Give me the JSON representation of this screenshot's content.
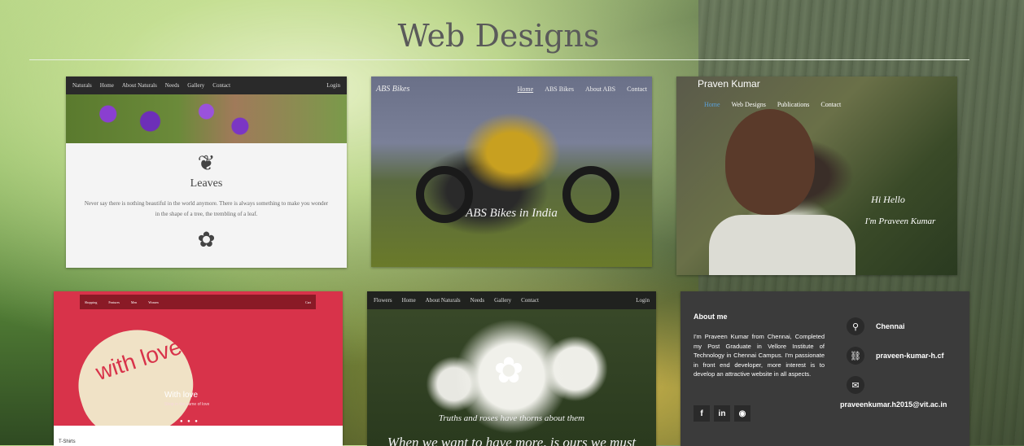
{
  "page": {
    "title": "Web Designs"
  },
  "cards": {
    "naturals": {
      "nav": [
        "Naturals",
        "Home",
        "About Naturals",
        "Needs",
        "Gallery",
        "Contact"
      ],
      "login": "Login",
      "heading": "Leaves",
      "paragraph": "Never say there is nothing beautiful in the world anymore. There is always something to make you wonder in the shape of a tree, the trembling of a leaf."
    },
    "bikes": {
      "logo": "ABS Bikes",
      "nav": [
        "Home",
        "ABS Bikes",
        "About ABS",
        "Contact"
      ],
      "caption": "ABS Bikes in India"
    },
    "portfolio": {
      "name": "Praven Kumar",
      "nav": [
        "Home",
        "Web Designs",
        "Publications",
        "Contact"
      ],
      "greeting1": "Hi Hello",
      "greeting2": "I'm Praveen Kumar"
    },
    "shopping": {
      "nav": [
        "Shopping",
        "Features",
        "Men",
        "Women"
      ],
      "cart": "Cart",
      "heart_text": "with love",
      "caption": "With love",
      "subcaption": "Shop in the name of love",
      "bottom_label": "T-Shirts"
    },
    "flowers": {
      "nav": [
        "Flowers",
        "Home",
        "About Naturals",
        "Needs",
        "Gallery",
        "Contact"
      ],
      "login": "Login",
      "caption1": "Truths and roses have thorns about them",
      "caption2": "When we want to have more, is ours we must"
    },
    "about": {
      "heading": "About me",
      "paragraph": "I'm Praveen Kumar from Chennai, Completed my Post Graduate in Vellore Institute of Technology in Chennai Campus. I'm passionate in front end developer, more interest is to develop an attractive website in all aspects.",
      "location": "Chennai",
      "website": "praveen-kumar-h.cf",
      "email": "praveenkumar.h2015@vit.ac.in",
      "socials": [
        "f",
        "in",
        "gh"
      ]
    }
  }
}
